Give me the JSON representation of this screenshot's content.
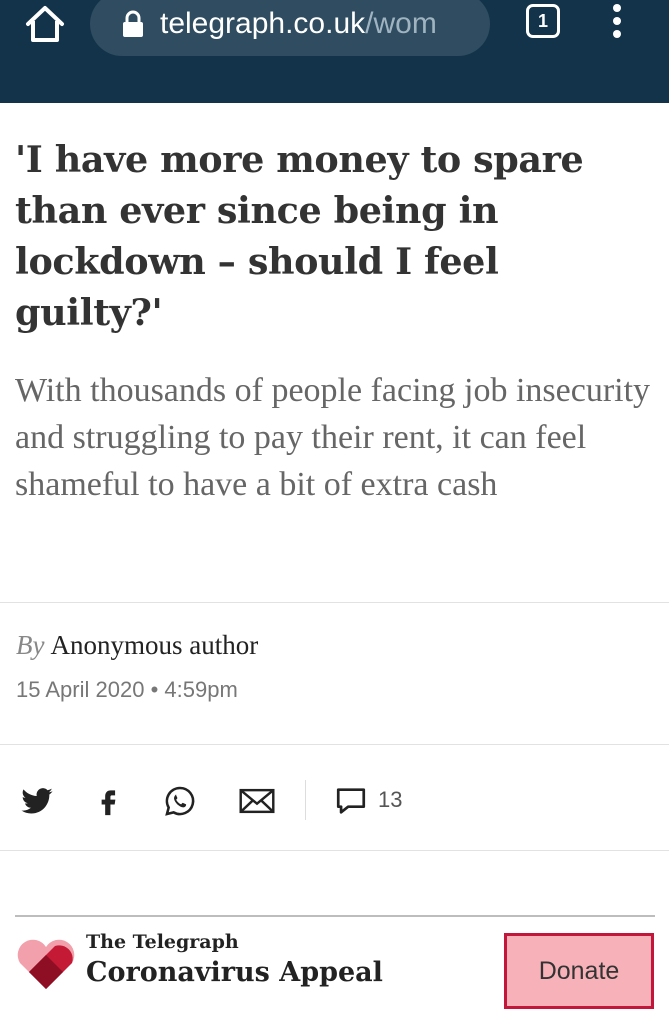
{
  "browser": {
    "url_host": "telegraph.co.uk",
    "url_path": "/wom",
    "tab_count": "1",
    "icons": [
      "home-icon",
      "lock-icon",
      "tab-switcher-icon",
      "overflow-menu-icon"
    ]
  },
  "article": {
    "headline": "'I have more money to spare than ever since being in lockdown – should I feel guilty?'",
    "standfirst": "With thousands of people facing job insecurity and struggling to pay their rent, it can feel shameful to have a bit of extra cash",
    "byline_prefix": "By",
    "author": "Anonymous author",
    "date": "15 April 2020",
    "separator": "•",
    "time": "4:59pm"
  },
  "share": {
    "icons": [
      "twitter-icon",
      "facebook-icon",
      "whatsapp-icon",
      "email-icon",
      "comment-icon"
    ],
    "comment_count": "13"
  },
  "appeal": {
    "brand": "The Telegraph",
    "title": "Coronavirus Appeal",
    "donate_label": "Donate",
    "colors": {
      "heart_light": "#f2a0ab",
      "heart_dark": "#b3122e",
      "button_bg": "#f7b2b9",
      "button_border": "#c2163a"
    }
  },
  "colors": {
    "browser_bar": "#123349",
    "url_pill": "#2f4c60"
  }
}
